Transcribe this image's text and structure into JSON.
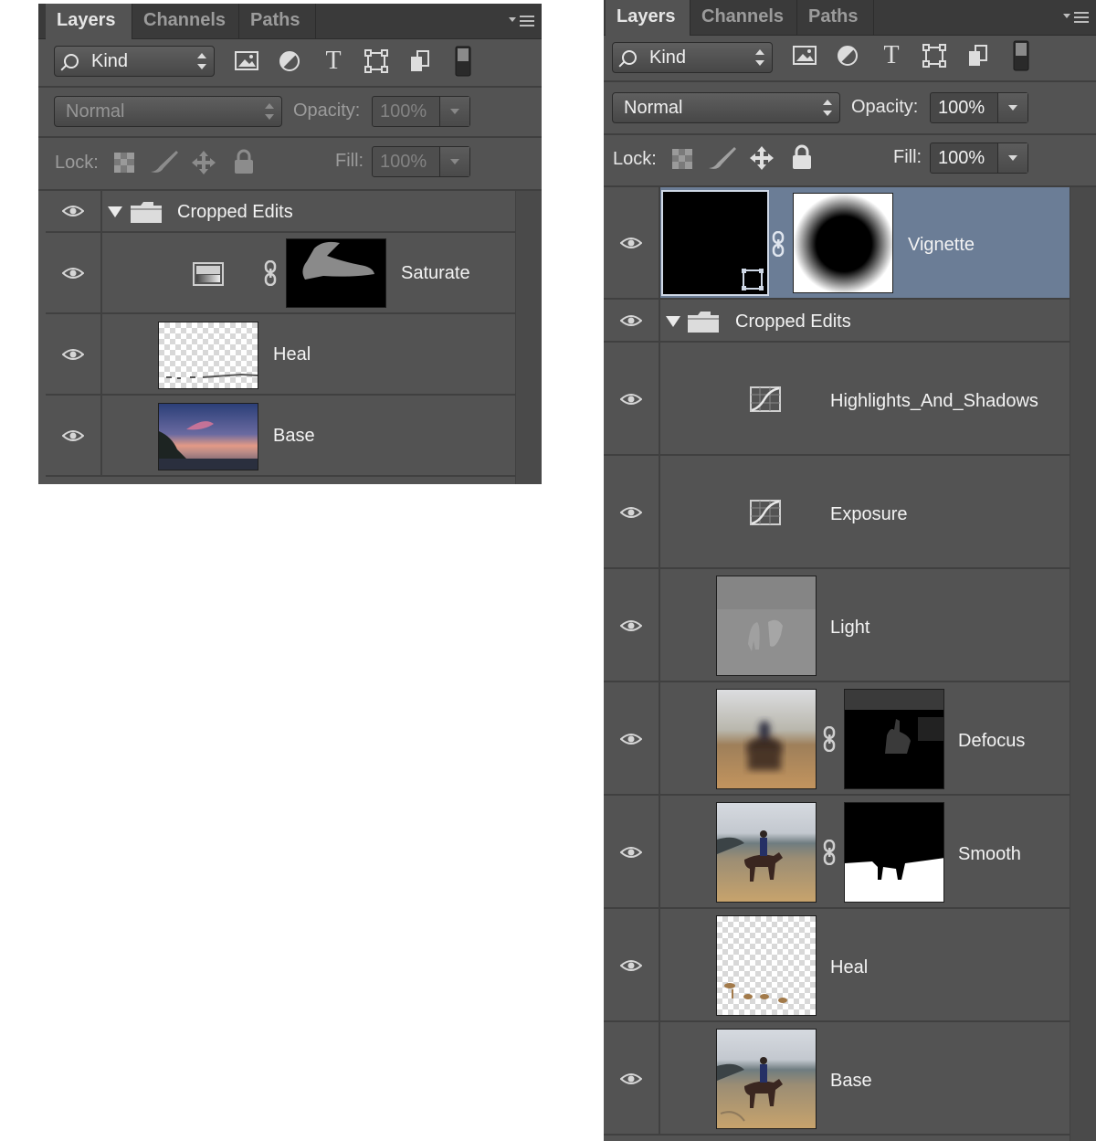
{
  "panel_a": {
    "tabs": [
      "Layers",
      "Channels",
      "Paths"
    ],
    "filter_kind": "Kind",
    "blend_mode": "Normal",
    "opacity_label": "Opacity:",
    "opacity_value": "100%",
    "lock_label": "Lock:",
    "fill_label": "Fill:",
    "fill_value": "100%",
    "group": {
      "name": "Cropped Edits",
      "expanded": true
    },
    "layers": [
      {
        "name": "Saturate",
        "kind": "adjustment-gradient-map",
        "mask": true
      },
      {
        "name": "Heal",
        "kind": "pixel-transparent"
      },
      {
        "name": "Base",
        "kind": "photo-sunset"
      }
    ]
  },
  "panel_b": {
    "tabs": [
      "Layers",
      "Channels",
      "Paths"
    ],
    "filter_kind": "Kind",
    "blend_mode": "Normal",
    "opacity_label": "Opacity:",
    "opacity_value": "100%",
    "lock_label": "Lock:",
    "fill_label": "Fill:",
    "fill_value": "100%",
    "top_layer": {
      "name": "Vignette",
      "selected": true
    },
    "group": {
      "name": "Cropped Edits",
      "expanded": true
    },
    "layers": [
      {
        "name": "Highlights_And_Shadows",
        "kind": "adjustment-curves"
      },
      {
        "name": "Exposure",
        "kind": "adjustment-curves"
      },
      {
        "name": "Light",
        "kind": "pixel-gray"
      },
      {
        "name": "Defocus",
        "kind": "photo-blur",
        "mask": true
      },
      {
        "name": "Smooth",
        "kind": "photo-beach",
        "mask": true
      },
      {
        "name": "Heal",
        "kind": "pixel-transparent"
      },
      {
        "name": "Base",
        "kind": "photo-beach"
      }
    ]
  },
  "colors": {
    "panel_bg": "#535353",
    "tab_bar": "#3a3a3a",
    "selected_row": "#6b7d96",
    "text": "#f3f3f3"
  }
}
